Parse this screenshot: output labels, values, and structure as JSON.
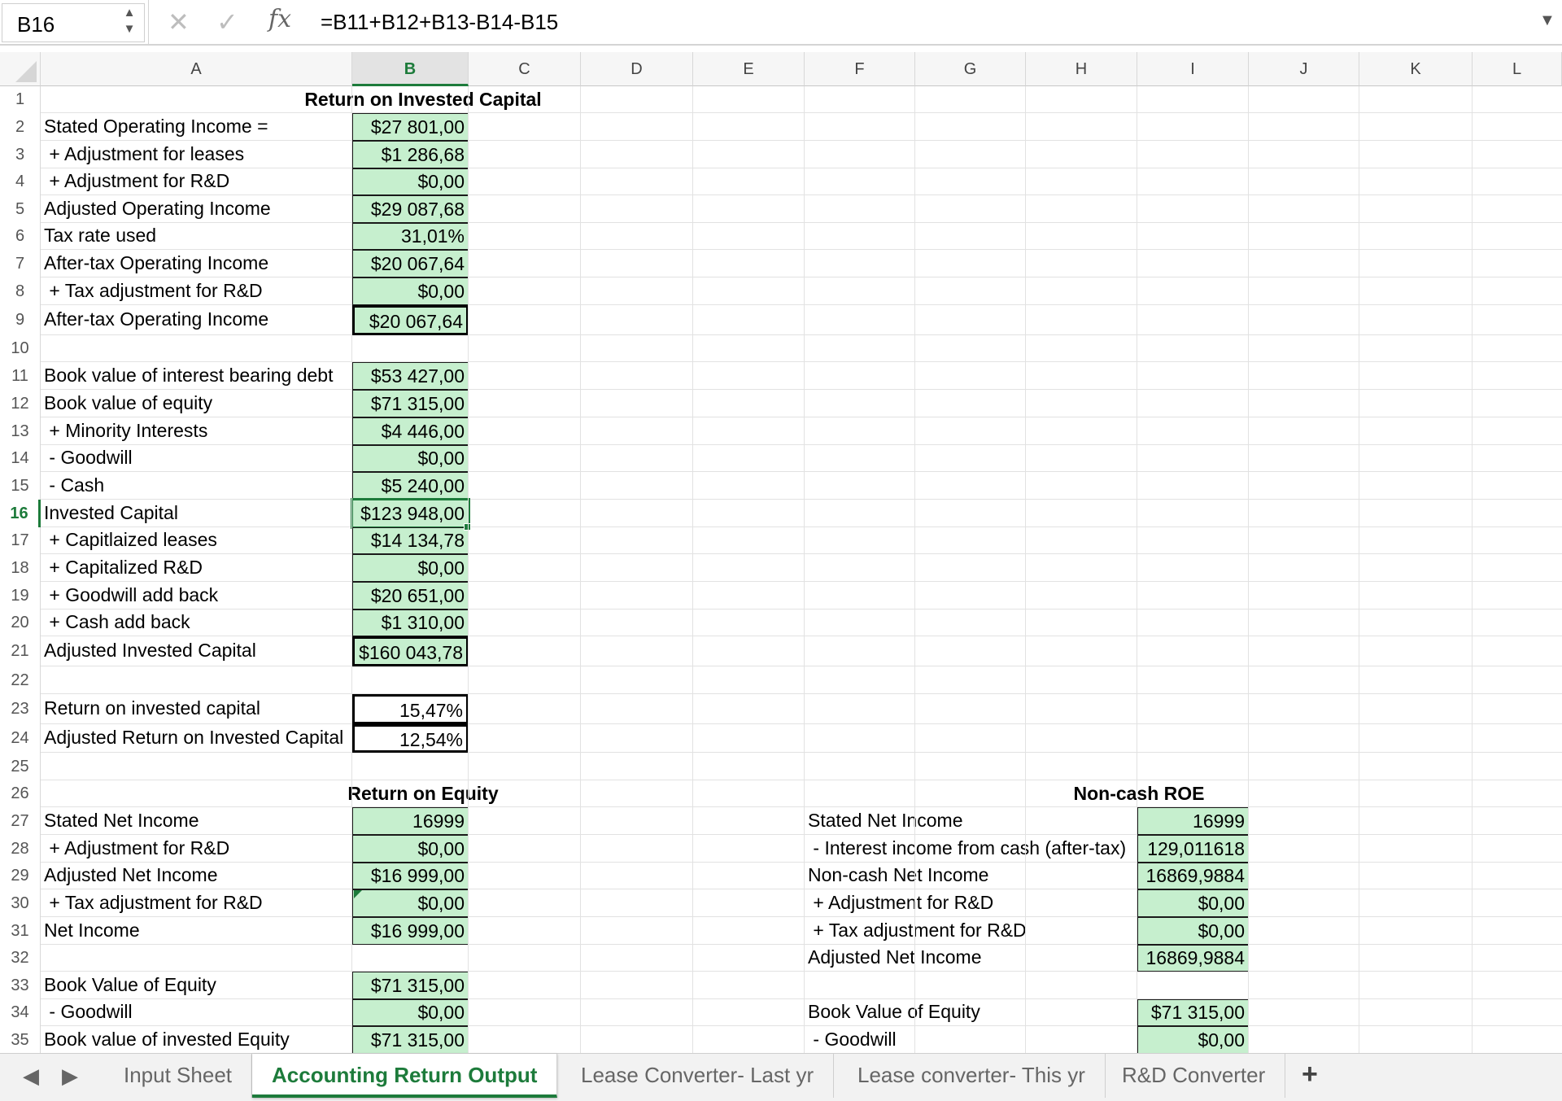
{
  "formula_bar": {
    "cell_ref": "B16",
    "cancel_glyph": "✕",
    "accept_glyph": "✓",
    "fx_label": "fx",
    "formula": "=B11+B12+B13-B14-B15"
  },
  "columns": [
    "A",
    "B",
    "C",
    "D",
    "E",
    "F",
    "G",
    "H",
    "I",
    "J",
    "K",
    "L"
  ],
  "rows": [
    "1",
    "2",
    "3",
    "4",
    "5",
    "6",
    "7",
    "8",
    "9",
    "10",
    "11",
    "12",
    "13",
    "14",
    "15",
    "16",
    "17",
    "18",
    "19",
    "20",
    "21",
    "22",
    "23",
    "24",
    "25",
    "26",
    "27",
    "28",
    "29",
    "30",
    "31",
    "32",
    "33",
    "34",
    "35"
  ],
  "selection": {
    "column": "B",
    "row": "16"
  },
  "headers": {
    "roic": "Return on Invested Capital",
    "roe": "Return on Equity",
    "noncash_roe": "Non-cash ROE"
  },
  "cells": {
    "A2": "Stated Operating Income =",
    "B2": "$27 801,00",
    "A3": " + Adjustment for leases",
    "B3": "$1 286,68",
    "A4": " + Adjustment for R&D",
    "B4": "$0,00",
    "A5": "Adjusted Operating Income",
    "B5": "$29 087,68",
    "A6": "Tax rate used",
    "B6": "31,01%",
    "A7": "After-tax Operating Income",
    "B7": "$20 067,64",
    "A8": " + Tax adjustment for R&D",
    "B8": "$0,00",
    "A9": "After-tax Operating Income",
    "B9": "$20 067,64",
    "A11": "Book value of interest bearing debt",
    "B11": "$53 427,00",
    "A12": "Book value of equity",
    "B12": "$71 315,00",
    "A13": " + Minority Interests",
    "B13": "$4 446,00",
    "A14": " - Goodwill",
    "B14": "$0,00",
    "A15": " - Cash",
    "B15": "$5 240,00",
    "A16": "Invested Capital",
    "B16": "$123 948,00",
    "A17": " + Capitlaized leases",
    "B17": "$14 134,78",
    "A18": " + Capitalized R&D",
    "B18": "$0,00",
    "A19": " + Goodwill add back",
    "B19": "$20 651,00",
    "A20": " + Cash add back",
    "B20": "$1 310,00",
    "A21": "Adjusted Invested Capital",
    "B21": "$160 043,78",
    "A23": "Return on invested capital",
    "B23": "15,47%",
    "A24": "Adjusted Return on Invested Capital",
    "B24": "12,54%",
    "A27": "Stated Net Income",
    "B27": "16999",
    "A28": " + Adjustment for R&D",
    "B28": "$0,00",
    "A29": "Adjusted Net Income",
    "B29": "$16 999,00",
    "A30": " + Tax adjustment for R&D",
    "B30": "$0,00",
    "A31": "Net Income",
    "B31": "$16 999,00",
    "A33": "Book Value of Equity",
    "B33": "$71 315,00",
    "A34": " - Goodwill",
    "B34": "$0,00",
    "A35": "Book value of invested Equity",
    "B35": "$71 315,00",
    "F27": "Stated Net Income",
    "I27": "16999",
    "F28": " - Interest income from cash (after-tax)",
    "I28": "129,011618",
    "F29": "Non-cash Net Income",
    "I29": "16869,9884",
    "F30": " + Adjustment for R&D",
    "I30": "$0,00",
    "F31": " + Tax adjustment for R&D",
    "I31": "$0,00",
    "F32": "Adjusted Net Income",
    "I32": "16869,9884",
    "F34": "Book Value of Equity",
    "I34": "$71 315,00",
    "F35": " - Goodwill",
    "I35": "$0,00"
  },
  "sheet_tabs": {
    "prev_glyph": "◀",
    "next_glyph": "▶",
    "tabs": [
      "Input Sheet",
      "Accounting Return Output",
      "Lease Converter- Last yr",
      "Lease converter- This yr",
      "R&D Converter"
    ],
    "active_index": 1,
    "add_glyph": "+"
  },
  "colors": {
    "accent": "#1d7b3b",
    "value_fill": "#c6efce"
  },
  "icons": [
    "namebox-stepper-icon",
    "cancel-icon",
    "accept-icon",
    "fx-icon",
    "dropdown-arrow-icon",
    "prev-sheet-icon",
    "next-sheet-icon",
    "add-sheet-icon"
  ]
}
